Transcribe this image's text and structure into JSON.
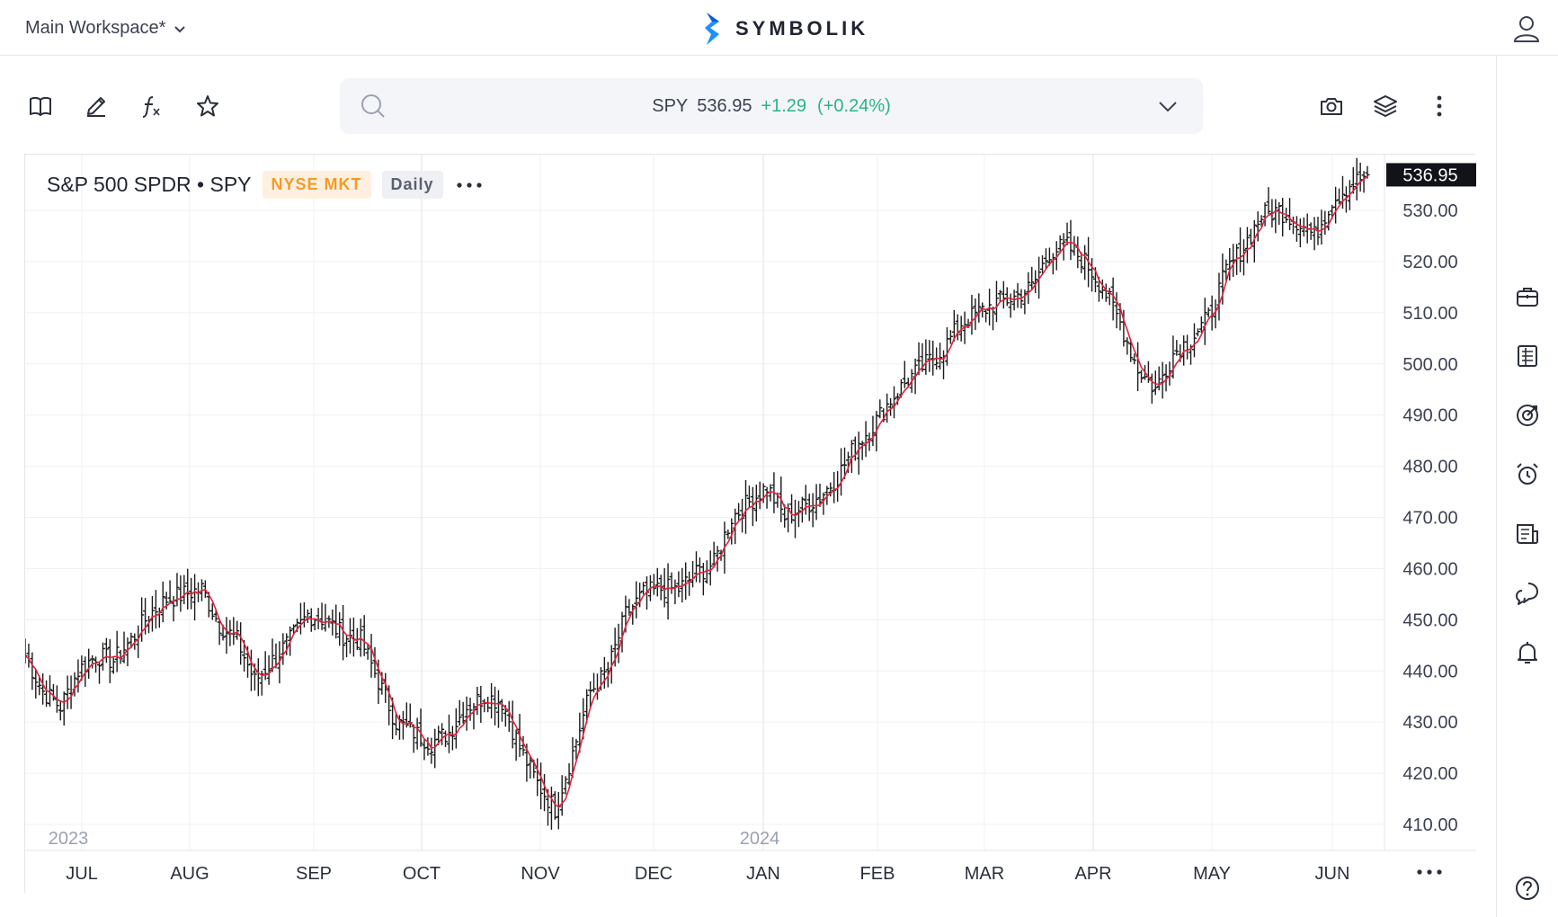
{
  "app": {
    "workspace_label": "Main Workspace*",
    "brand_name": "SYMBOLIK",
    "brand_color": "#1e90ff"
  },
  "toolbar": {
    "left_icons": [
      "book-icon",
      "pencil-icon",
      "function-icon",
      "star-icon"
    ],
    "right_icons": [
      "camera-icon",
      "layers-icon",
      "more-vertical-icon"
    ]
  },
  "quote": {
    "symbol": "SPY",
    "price": "536.95",
    "change": "+1.29",
    "change_pct": "(+0.24%)",
    "up_color": "#2bb38a"
  },
  "legend": {
    "title": "S&P 500 SPDR • SPY",
    "exchange": "NYSE MKT",
    "interval": "Daily"
  },
  "right_rail": {
    "icons": [
      "briefcase-icon",
      "list-icon",
      "target-icon",
      "alarm-clock-icon",
      "news-icon",
      "chat-icon",
      "bell-icon",
      "help-icon"
    ]
  },
  "chart_data": {
    "type": "ohlc",
    "interval": "Daily",
    "overlay": "moving average (red line)",
    "ylim": [
      406,
      540
    ],
    "y_ticks": [
      "530.00",
      "520.00",
      "510.00",
      "500.00",
      "490.00",
      "480.00",
      "470.00",
      "460.00",
      "450.00",
      "440.00",
      "430.00",
      "420.00",
      "410.00"
    ],
    "y_tick_values": [
      530,
      520,
      510,
      500,
      490,
      480,
      470,
      460,
      450,
      440,
      430,
      420,
      410
    ],
    "x_tick_labels": [
      "JUL",
      "AUG",
      "SEP",
      "OCT",
      "NOV",
      "DEC",
      "JAN",
      "FEB",
      "MAR",
      "APR",
      "MAY",
      "JUN"
    ],
    "year_labels": [
      "2023",
      "2024"
    ],
    "last_price_label": "536.95",
    "last_price": 536.95,
    "date_range": [
      "2023-06-26",
      "2024-06-14"
    ],
    "closes_weekly_approx": [
      443,
      436,
      433,
      440,
      443,
      442,
      446,
      451,
      454,
      455,
      456,
      449,
      446,
      438,
      442,
      446,
      451,
      450,
      447,
      446,
      438,
      430,
      428,
      426,
      428,
      433,
      435,
      434,
      425,
      418,
      413,
      424,
      436,
      440,
      451,
      455,
      456,
      456,
      459,
      461,
      470,
      473,
      476,
      470,
      472,
      474,
      478,
      484,
      488,
      493,
      497,
      500,
      503,
      508,
      510,
      512,
      513,
      515,
      522,
      523,
      520,
      515,
      508,
      499,
      495,
      502,
      505,
      509,
      518,
      523,
      529,
      530,
      528,
      525,
      532,
      535,
      536.95
    ],
    "series_colors": {
      "bars": "#1a1a1a",
      "moving_average": "#e0233d"
    }
  }
}
